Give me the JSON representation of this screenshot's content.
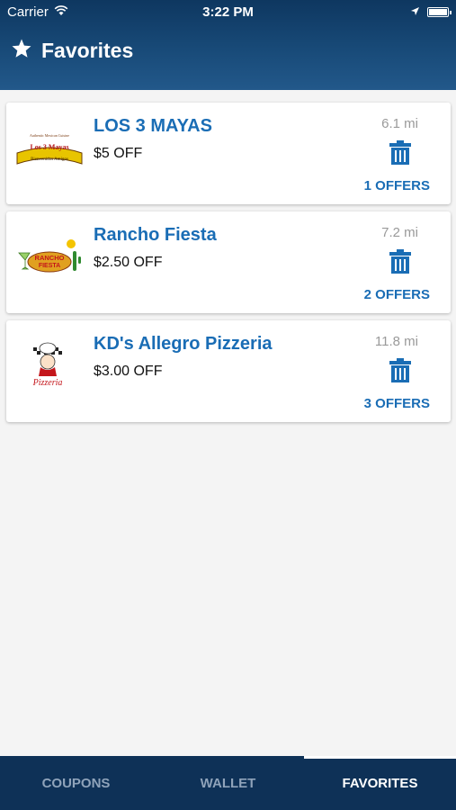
{
  "status_bar": {
    "carrier": "Carrier",
    "time": "3:22 PM"
  },
  "header": {
    "title": "Favorites",
    "icon": "star-icon"
  },
  "favorites": [
    {
      "name": "LOS 3 MAYAS",
      "offer": "$5 OFF",
      "distance": "6.1 mi",
      "offers_count": "1 OFFERS"
    },
    {
      "name": "Rancho Fiesta",
      "offer": "$2.50 OFF",
      "distance": "7.2 mi",
      "offers_count": "2 OFFERS"
    },
    {
      "name": "KD's Allegro Pizzeria",
      "offer": "$3.00 OFF",
      "distance": "11.8 mi",
      "offers_count": "3 OFFERS"
    }
  ],
  "logos": {
    "los3mayas": {
      "line1": "Authentic Mexican Cuisine",
      "line2": "Los 3 Mayas",
      "line3": "Bienvenidos Amigos"
    },
    "rancho": {
      "line1": "RANCHO",
      "line2": "FIESTA"
    },
    "kds": {
      "line1": "Pizzeria"
    }
  },
  "tabs": [
    {
      "label": "COUPONS",
      "active": false
    },
    {
      "label": "WALLET",
      "active": false
    },
    {
      "label": "FAVORITES",
      "active": true
    }
  ],
  "colors": {
    "header_bg": "#184a78",
    "accent_blue": "#1a6db5",
    "tabbar_bg": "#0e3157"
  }
}
